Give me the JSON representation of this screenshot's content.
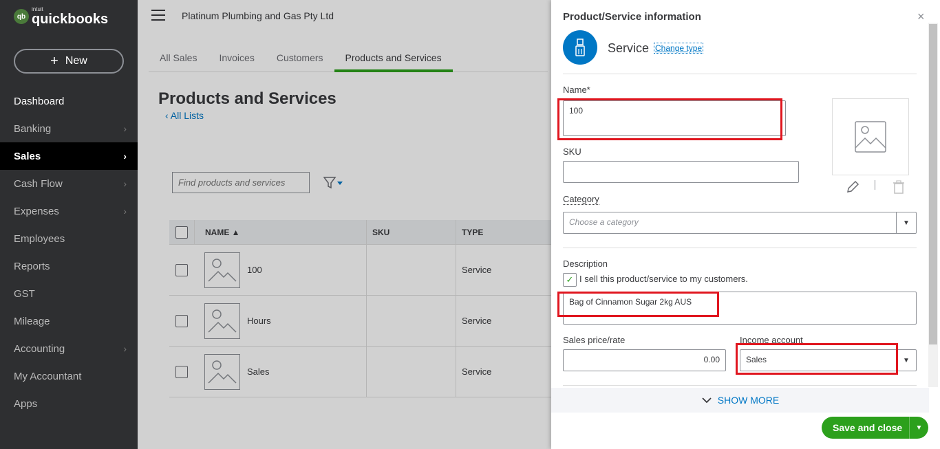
{
  "sidebar": {
    "logo_intuit": "intuit",
    "logo_name": "quickbooks",
    "new_label": "New",
    "items": [
      {
        "label": "Dashboard",
        "chevron": false
      },
      {
        "label": "Banking",
        "chevron": true
      },
      {
        "label": "Sales",
        "chevron": true,
        "active": true
      },
      {
        "label": "Cash Flow",
        "chevron": true
      },
      {
        "label": "Expenses",
        "chevron": true
      },
      {
        "label": "Employees",
        "chevron": false
      },
      {
        "label": "Reports",
        "chevron": false
      },
      {
        "label": "GST",
        "chevron": false
      },
      {
        "label": "Mileage",
        "chevron": false
      },
      {
        "label": "Accounting",
        "chevron": true
      },
      {
        "label": "My Accountant",
        "chevron": false
      },
      {
        "label": "Apps",
        "chevron": false
      }
    ]
  },
  "header": {
    "company": "Platinum Plumbing and Gas Pty Ltd"
  },
  "tabs": [
    {
      "label": "All Sales"
    },
    {
      "label": "Invoices"
    },
    {
      "label": "Customers"
    },
    {
      "label": "Products and Services",
      "active": true
    }
  ],
  "page": {
    "title": "Products and Services",
    "all_lists": "All Lists",
    "search_placeholder": "Find products and services"
  },
  "table": {
    "columns": [
      "NAME ▲",
      "SKU",
      "TYPE"
    ],
    "rows": [
      {
        "name": "100",
        "sku": "",
        "type": "Service"
      },
      {
        "name": "Hours",
        "sku": "",
        "type": "Service"
      },
      {
        "name": "Sales",
        "sku": "",
        "type": "Service"
      }
    ]
  },
  "panel": {
    "title": "Product/Service information",
    "service_label": "Service",
    "change_type": "Change type",
    "name_label": "Name*",
    "name_value": "100",
    "sku_label": "SKU",
    "sku_value": "",
    "category_label": "Category",
    "category_placeholder": "Choose a category",
    "description_label": "Description",
    "sell_checkbox_label": "I sell this product/service to my customers.",
    "description_value": "Bag of Cinnamon Sugar 2kg AUS",
    "price_label": "Sales price/rate",
    "price_value": "0.00",
    "income_label": "Income account",
    "income_value": "Sales",
    "show_more": "SHOW MORE",
    "save_label": "Save and close"
  },
  "colors": {
    "sidebar_bg": "#2e2f31",
    "accent_green": "#2ca01c",
    "link_blue": "#0077c5",
    "highlight_red": "#e0161f"
  }
}
